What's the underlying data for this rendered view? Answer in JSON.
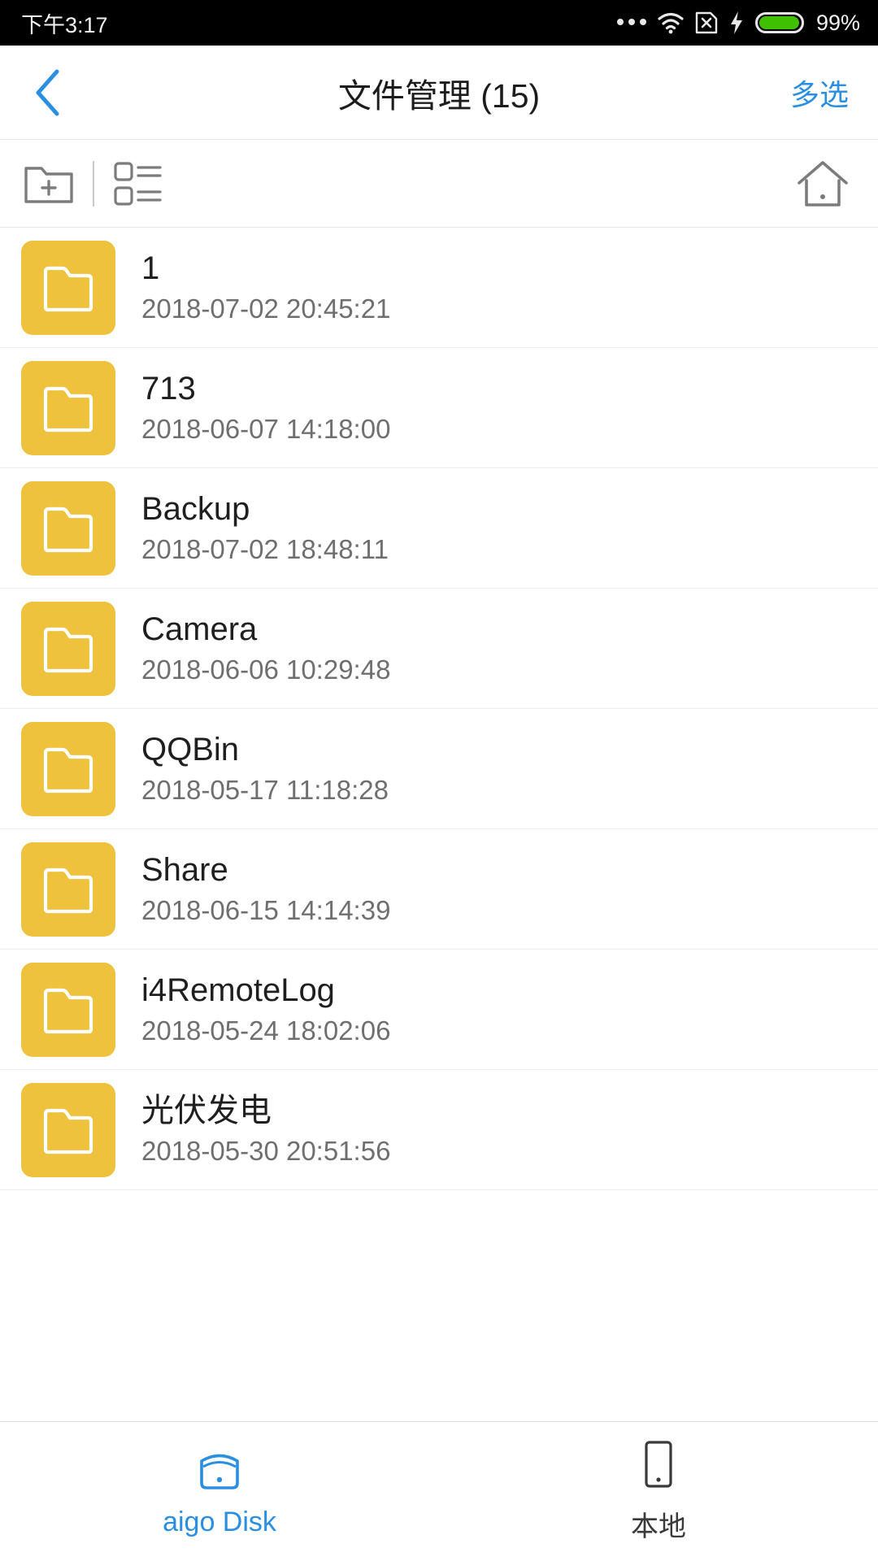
{
  "statusbar": {
    "time": "下午3:17",
    "battery_percent": "99%",
    "icons": [
      "more-dots-icon",
      "wifi-icon",
      "no-sim-icon",
      "charging-bolt-icon",
      "battery-icon"
    ],
    "battery_fill_color": "#3fc000",
    "background": "#000000"
  },
  "header": {
    "back_icon": "chevron-left-icon",
    "title": "文件管理 (15)",
    "multi_select_label": "多选",
    "accent_color": "#2a8fe0"
  },
  "toolbar": {
    "new_folder_icon": "new-folder-icon",
    "list_view_icon": "list-view-icon",
    "home_icon": "home-icon",
    "icon_color": "#7c7c7c"
  },
  "list": {
    "folder_color": "#eec23c",
    "items": [
      {
        "name": "1",
        "date": "2018-07-02 20:45:21",
        "icon": "folder-icon"
      },
      {
        "name": "713",
        "date": "2018-06-07 14:18:00",
        "icon": "folder-icon"
      },
      {
        "name": "Backup",
        "date": "2018-07-02 18:48:11",
        "icon": "folder-icon"
      },
      {
        "name": "Camera",
        "date": "2018-06-06 10:29:48",
        "icon": "folder-icon"
      },
      {
        "name": "QQBin",
        "date": "2018-05-17 11:18:28",
        "icon": "folder-icon"
      },
      {
        "name": "Share",
        "date": "2018-06-15 14:14:39",
        "icon": "folder-icon"
      },
      {
        "name": "i4RemoteLog",
        "date": "2018-05-24 18:02:06",
        "icon": "folder-icon"
      },
      {
        "name": "光伏发电",
        "date": "2018-05-30 20:51:56",
        "icon": "folder-icon"
      }
    ]
  },
  "bottomnav": {
    "items": [
      {
        "label": "aigo Disk",
        "icon": "external-disk-icon",
        "active": true
      },
      {
        "label": "本地",
        "icon": "phone-icon",
        "active": false
      }
    ],
    "active_color": "#2a8fe0",
    "inactive_color": "#3a3a3a"
  }
}
